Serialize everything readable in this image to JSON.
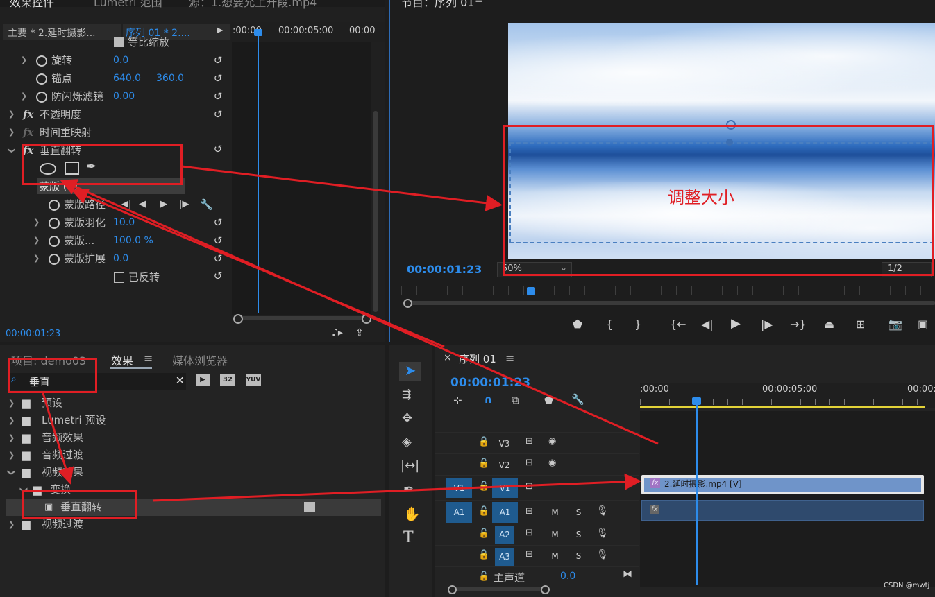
{
  "effect_controls": {
    "tab_label": "效果控件",
    "tab2_label": "Lumetri 范围",
    "tab3_label": "源：1.想要允上升段.mp4",
    "source_label": "主要 * 2.延时摄影...",
    "sequence_label": "序列 01 * 2....",
    "time_start": ":00:00",
    "time_mid": "00:00:05:00",
    "time_end": "00:00",
    "uniform_scale": "等比缩放",
    "rows": [
      {
        "label": "旋转",
        "value": "0.0"
      },
      {
        "label": "锚点",
        "value": "640.0",
        "value2": "360.0"
      },
      {
        "label": "防闪烁滤镜",
        "value": "0.00"
      },
      {
        "label": "不透明度"
      },
      {
        "label": "时间重映射"
      },
      {
        "label": "垂直翻转"
      }
    ],
    "mask_label": "蒙版 (1)",
    "mask_rows": [
      {
        "label": "蒙版路径"
      },
      {
        "label": "蒙版羽化",
        "value": "10.0"
      },
      {
        "label": "蒙版...",
        "value": "100.0 %"
      },
      {
        "label": "蒙版扩展",
        "value": "0.0"
      },
      {
        "label": "已反转"
      }
    ],
    "current_time": "00:00:01:23"
  },
  "program": {
    "title": "节目：序列 01",
    "timecode": "00:00:01:23",
    "zoom": "50%",
    "resolution": "1/2",
    "overlay_text": "调整大小"
  },
  "project": {
    "tab_project": "项目: demo03",
    "tab_effects": "效果",
    "tab_media": "媒体浏览器",
    "search_value": "垂直",
    "badge_32": "32",
    "badge_yuv": "YUV",
    "tree": [
      {
        "label": "预设"
      },
      {
        "label": "Lumetri 预设"
      },
      {
        "label": "音频效果"
      },
      {
        "label": "音频过渡"
      },
      {
        "label": "视频效果"
      },
      {
        "label": "变换"
      },
      {
        "label": "垂直翻转"
      },
      {
        "label": "视频过渡"
      }
    ]
  },
  "timeline": {
    "close": "×",
    "title": "序列 01",
    "timecode": "00:00:01:23",
    "ruler_start": ":00:00",
    "ruler_mid": "00:00:05:00",
    "ruler_end": "00:00:",
    "tracks": [
      {
        "src": "",
        "name": "V3",
        "extra": ""
      },
      {
        "src": "",
        "name": "V2",
        "extra": ""
      },
      {
        "src": "V1",
        "name": "V1",
        "extra": ""
      },
      {
        "src": "A1",
        "name": "A1",
        "m": "M",
        "s": "S"
      },
      {
        "src": "",
        "name": "A2",
        "m": "M",
        "s": "S"
      },
      {
        "src": "",
        "name": "A3",
        "m": "M",
        "s": "S"
      }
    ],
    "master_label": "主声道",
    "master_value": "0.0",
    "clip_label": "2.延时摄影.mp4 [V]",
    "fx_badge": "fx"
  },
  "watermark": "CSDN @mwtj",
  "colors": {
    "accent": "#2d8ceb",
    "annotation": "#e01e24"
  }
}
